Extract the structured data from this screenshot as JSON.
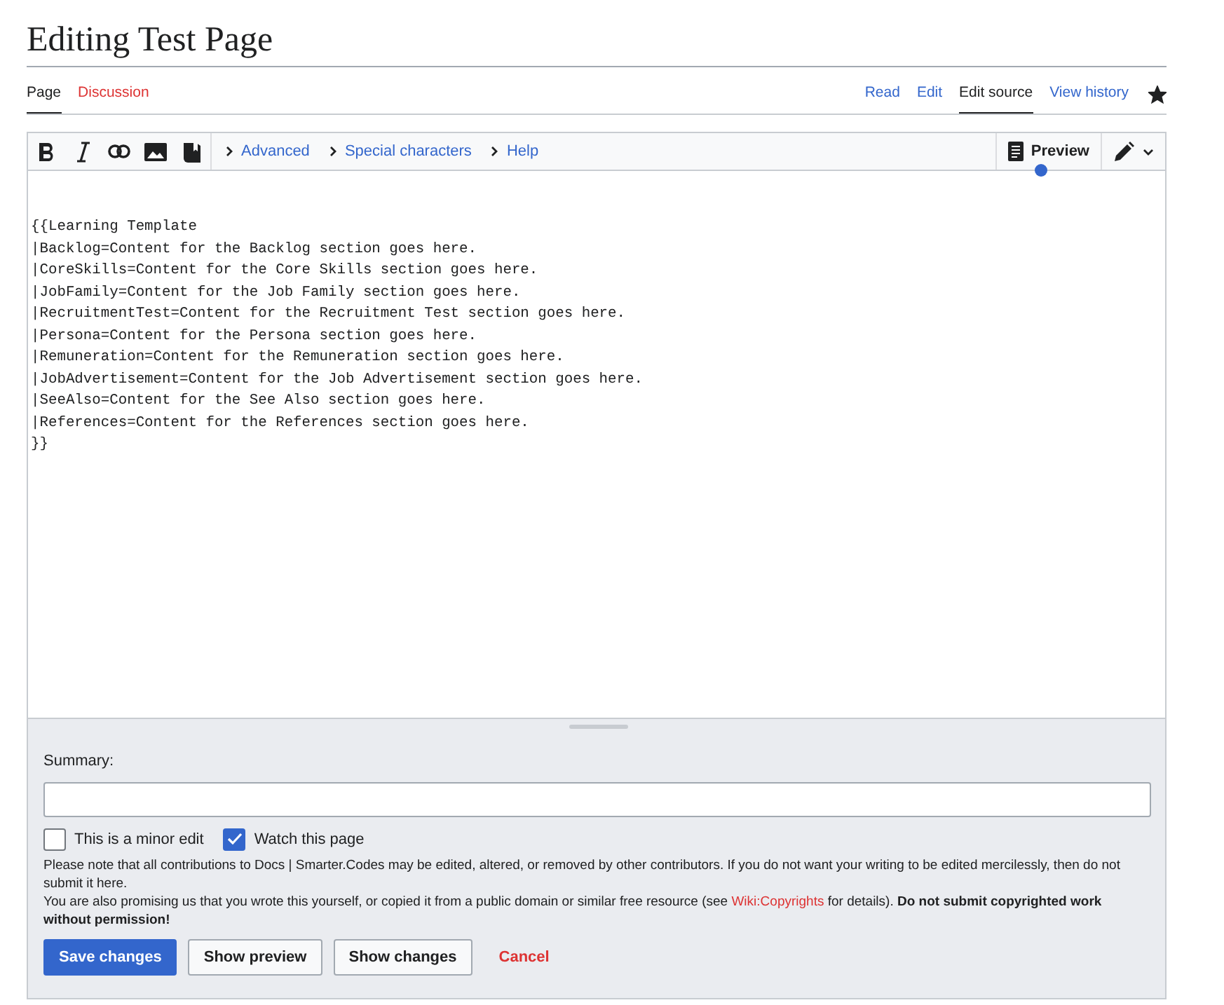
{
  "title": "Editing Test Page",
  "left_tabs": [
    {
      "label": "Page",
      "selected": true,
      "missing": false
    },
    {
      "label": "Discussion",
      "selected": false,
      "missing": true
    }
  ],
  "right_tabs": [
    {
      "label": "Read",
      "selected": false
    },
    {
      "label": "Edit",
      "selected": false
    },
    {
      "label": "Edit source",
      "selected": true
    },
    {
      "label": "View history",
      "selected": false
    }
  ],
  "watched": true,
  "toolbar": {
    "menus": [
      {
        "label": "Advanced",
        "expanded": false
      },
      {
        "label": "Special characters",
        "expanded": false
      },
      {
        "label": "Help",
        "expanded": false
      }
    ],
    "preview": {
      "label": "Preview",
      "indicator": true
    }
  },
  "source": "\n\n{{Learning Template\n|Backlog=Content for the Backlog section goes here.\n|CoreSkills=Content for the Core Skills section goes here.\n|JobFamily=Content for the Job Family section goes here.\n|RecruitmentTest=Content for the Recruitment Test section goes here.\n|Persona=Content for the Persona section goes here.\n|Remuneration=Content for the Remuneration section goes here.\n|JobAdvertisement=Content for the Job Advertisement section goes here.\n|SeeAlso=Content for the See Also section goes here.\n|References=Content for the References section goes here.\n}}",
  "summary": {
    "label": "Summary:"
  },
  "options": [
    {
      "label": "This is a minor edit",
      "checked": false
    },
    {
      "label": "Watch this page",
      "checked": true
    }
  ],
  "notice": "Please note that all contributions to Docs | Smarter.Codes may be edited, altered, or removed by other contributors. If you do not want your writing to be edited mercilessly, then do not submit it here.",
  "promise": {
    "before": "You are also promising us that you wrote this yourself, or copied it from a public domain or similar free resource (see ",
    "link": "Wiki:Copyrights",
    "after": " for details). **Do not submit copyrighted work without permission!**"
  },
  "buttons": [
    {
      "label": "Save changes",
      "kind": "primary"
    },
    {
      "label": "Show preview",
      "kind": "normal"
    },
    {
      "label": "Show changes",
      "kind": "normal"
    },
    {
      "label": "Cancel",
      "kind": "destructive"
    }
  ]
}
